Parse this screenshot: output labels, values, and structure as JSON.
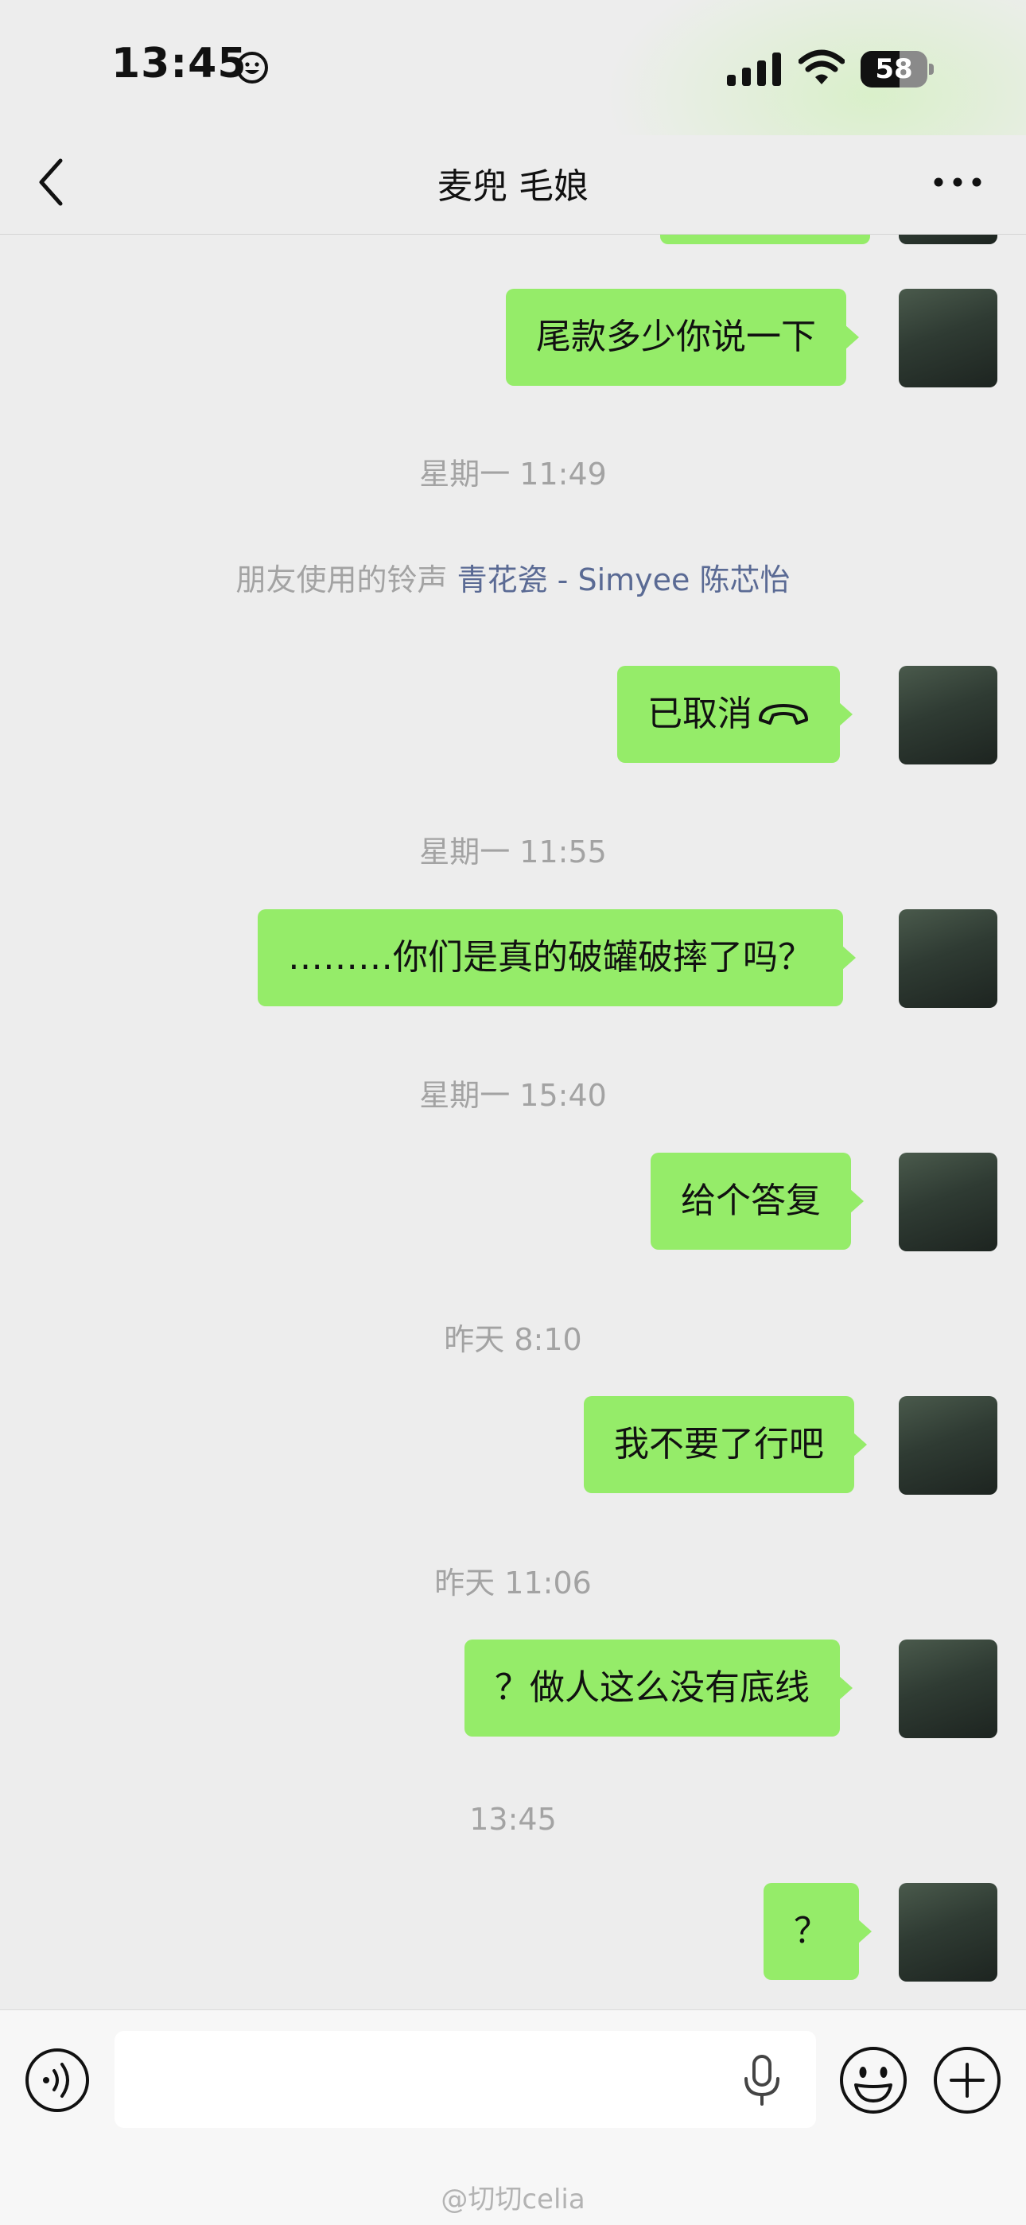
{
  "status_bar": {
    "time": "13:45",
    "battery": "58",
    "battery_level": 0.58
  },
  "header": {
    "title": "麦兜 毛娘"
  },
  "messages": [
    {
      "type": "bubble",
      "text": "尾款多少你说一下"
    },
    {
      "type": "timestamp",
      "text": "星期一 11:49"
    },
    {
      "type": "ringtone",
      "prefix": "朋友使用的铃声",
      "song": "青花瓷 - Simyee 陈芯怡"
    },
    {
      "type": "call",
      "text": "已取消"
    },
    {
      "type": "timestamp",
      "text": "星期一 11:55"
    },
    {
      "type": "bubble",
      "text": "………你们是真的破罐破摔了吗？"
    },
    {
      "type": "timestamp",
      "text": "星期一 15:40"
    },
    {
      "type": "bubble",
      "text": "给个答复"
    },
    {
      "type": "timestamp",
      "text": "昨天 8:10"
    },
    {
      "type": "bubble",
      "text": "我不要了行吧"
    },
    {
      "type": "timestamp",
      "text": "昨天 11:06"
    },
    {
      "type": "bubble",
      "text": "？做人这么没有底线"
    },
    {
      "type": "timestamp",
      "text": "13:45"
    },
    {
      "type": "bubble",
      "text": "？"
    }
  ],
  "input": {
    "placeholder": ""
  },
  "watermark": "@切切celia",
  "colors": {
    "bubble": "#95ec69",
    "background": "#ededed",
    "link": "#5a6a94",
    "timestamp": "#a3a3a3"
  },
  "icons": [
    "back-arrow",
    "more-dots",
    "voice",
    "microphone",
    "emoji",
    "plus",
    "phone-hangup",
    "signal",
    "wifi",
    "battery",
    "smiley"
  ]
}
